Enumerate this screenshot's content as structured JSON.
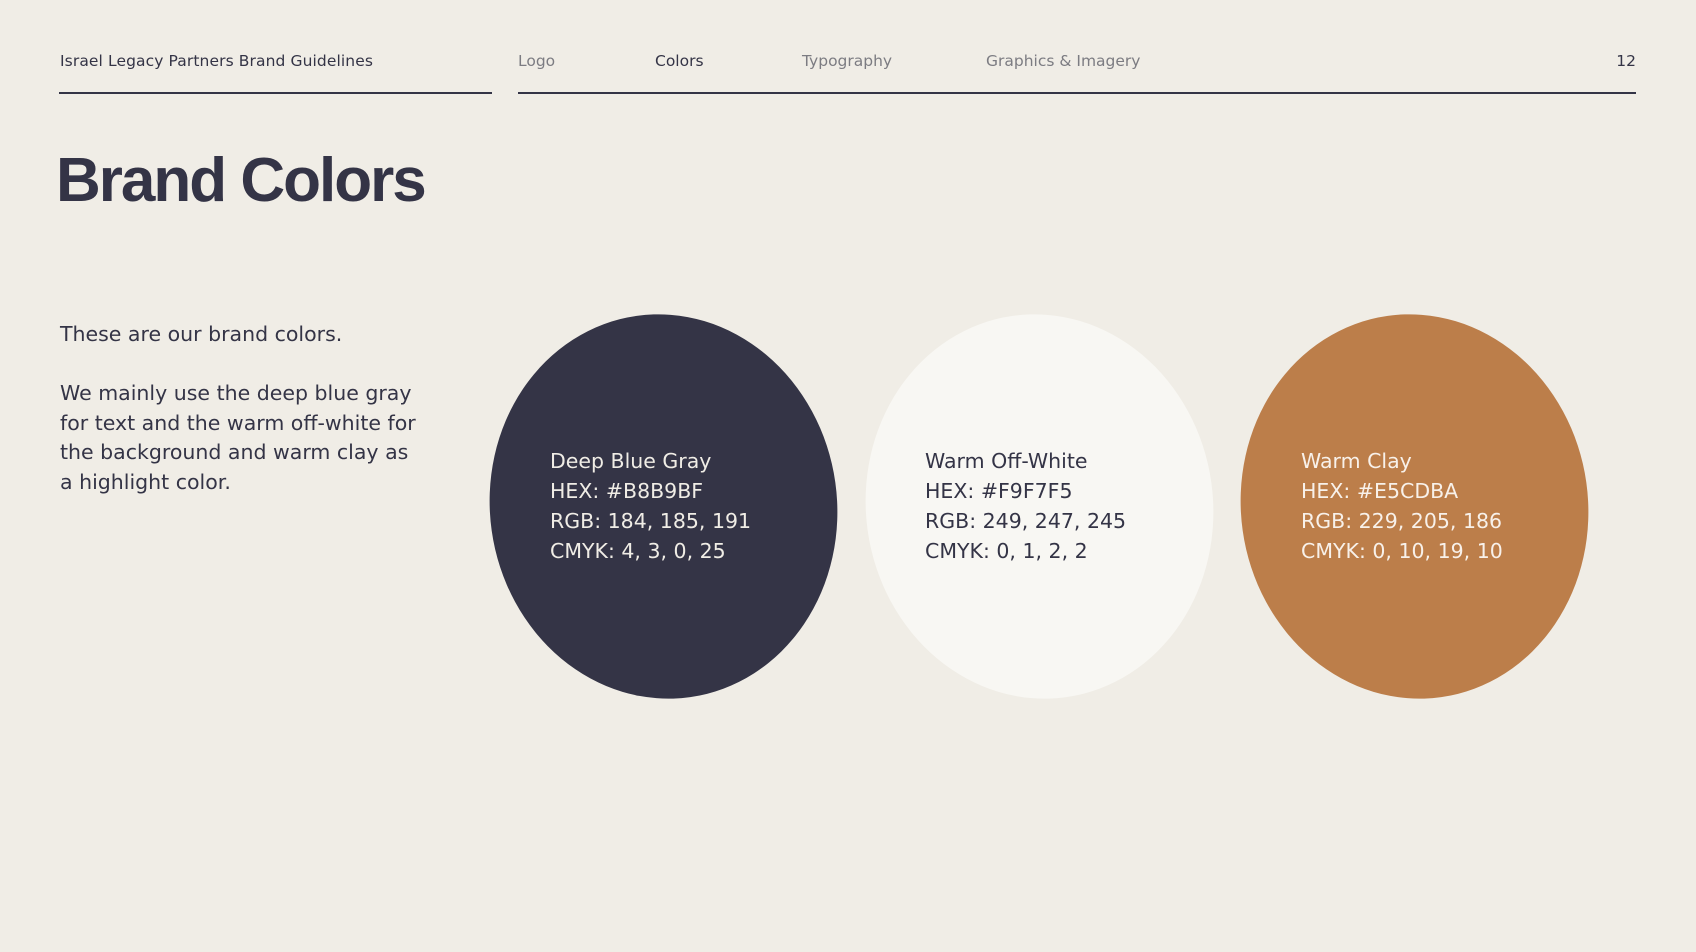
{
  "header": {
    "title": "Israel Legacy Partners Brand Guidelines",
    "nav": [
      {
        "label": "Logo",
        "active": false
      },
      {
        "label": "Colors",
        "active": true
      },
      {
        "label": "Typography",
        "active": false
      },
      {
        "label": "Graphics & Imagery",
        "active": false
      }
    ],
    "page_number": "12"
  },
  "page_title": "Brand Colors",
  "intro": {
    "line1": "These are our brand colors.",
    "line2": "We mainly use the deep blue gray for text and the warm off-white for the background and warm clay as a highlight color."
  },
  "swatches": [
    {
      "name": "Deep Blue Gray",
      "hex": "HEX: #B8B9BF",
      "rgb": "RGB: 184, 185, 191",
      "cmyk": "CMYK: 4, 3, 0, 25",
      "fill": "#343446",
      "text_color": "#F0EDE6"
    },
    {
      "name": "Warm Off-White",
      "hex": "HEX: #F9F7F5",
      "rgb": "RGB: 249, 247, 245",
      "cmyk": "CMYK: 0, 1, 2, 2",
      "fill": "#F8F7F3",
      "text_color": "#343446"
    },
    {
      "name": "Warm Clay",
      "hex": "HEX: #E5CDBA",
      "rgb": "RGB: 229, 205, 186",
      "cmyk": "CMYK: 0, 10, 19, 10",
      "fill": "#BC7E4A",
      "text_color": "#F8F1EA"
    }
  ]
}
